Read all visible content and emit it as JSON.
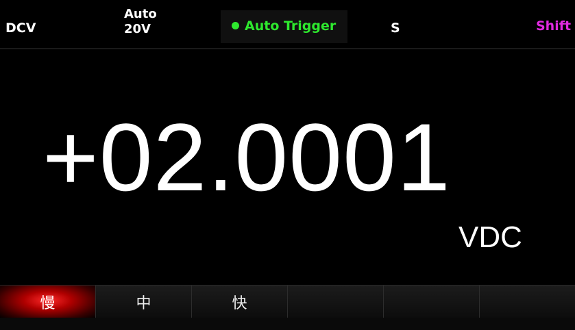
{
  "status": {
    "mode": "DCV",
    "range_line1": "Auto",
    "range_line2": "20V",
    "trigger": "Auto Trigger",
    "speed": "S",
    "shift": "Shift"
  },
  "reading": {
    "value": "+02.0001",
    "unit": "VDC"
  },
  "softkeys": [
    {
      "label": "慢",
      "active": true
    },
    {
      "label": "中",
      "active": false
    },
    {
      "label": "快",
      "active": false
    },
    {
      "label": "",
      "active": false
    },
    {
      "label": "",
      "active": false
    },
    {
      "label": "",
      "active": false
    }
  ],
  "colors": {
    "background": "#000000",
    "trigger_green": "#2ee82e",
    "shift_magenta": "#e02ae0",
    "active_softkey": "#cc0000",
    "text": "#ffffff"
  },
  "icons": {
    "trigger_indicator": "status-dot-icon"
  }
}
